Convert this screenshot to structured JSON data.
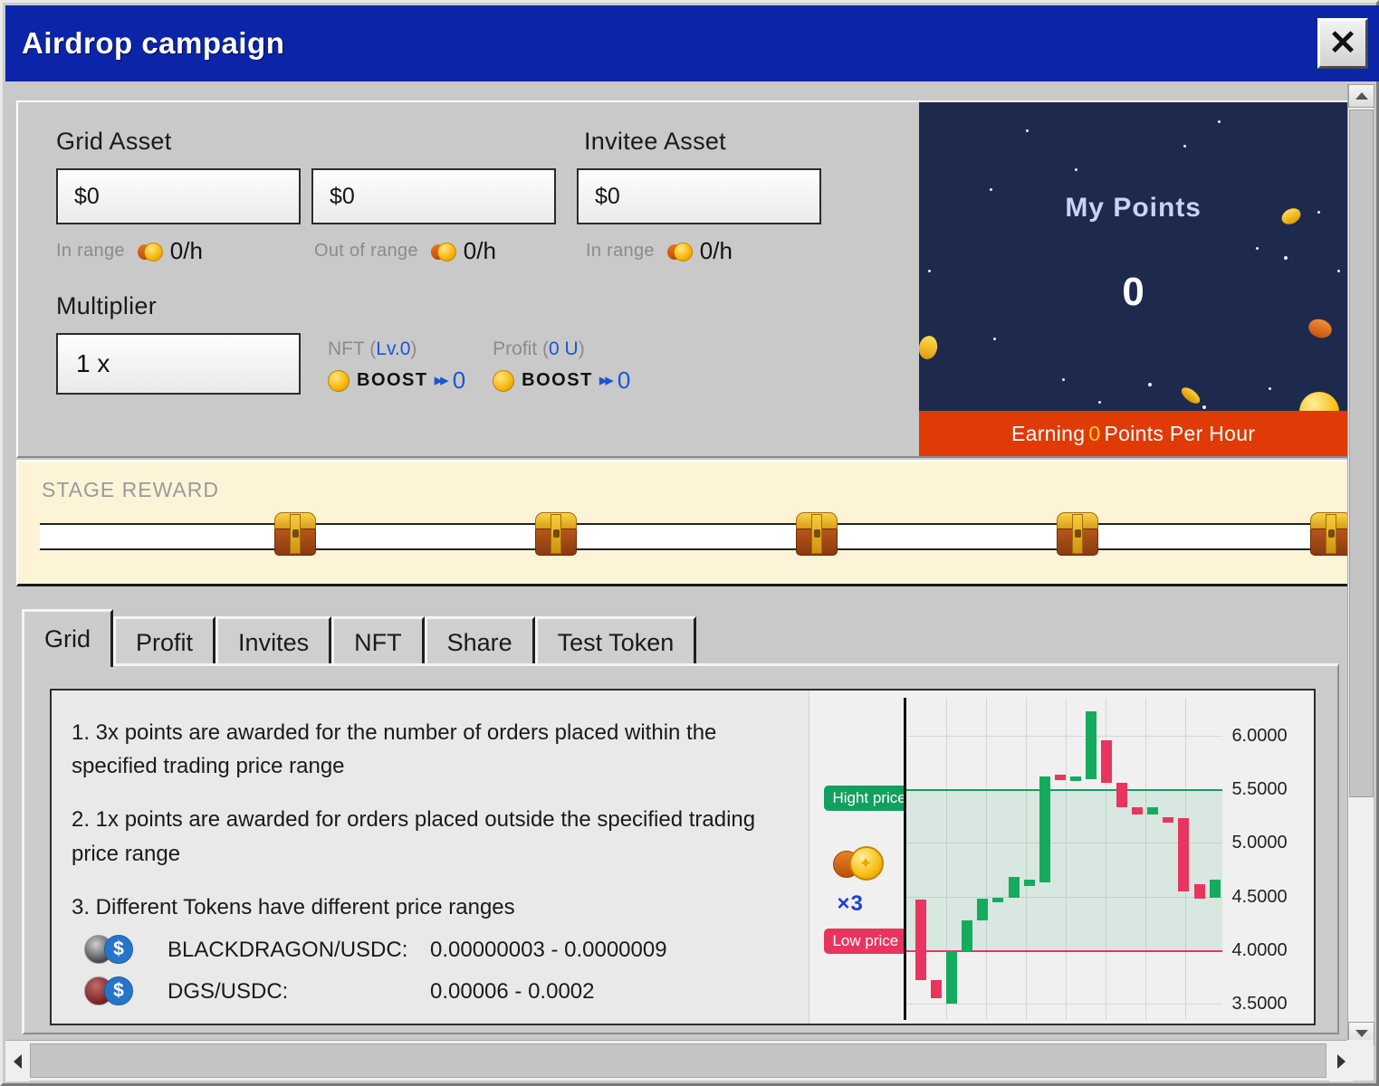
{
  "window": {
    "title": "Airdrop campaign",
    "close_label": "✕"
  },
  "stats": {
    "grid_asset_label": "Grid Asset",
    "invitee_asset_label": "Invitee Asset",
    "grid_in_value": "$0",
    "grid_out_value": "$0",
    "invitee_value": "$0",
    "in_range_label": "In range",
    "out_of_range_label": "Out of range",
    "invitee_in_range_label": "In range",
    "grid_in_rate": "0/h",
    "grid_out_rate": "0/h",
    "invitee_rate": "0/h",
    "multiplier_label": "Multiplier",
    "multiplier_value": "1 x",
    "nft_head_prefix": "NFT (",
    "nft_head_value": "Lv.0",
    "nft_head_suffix": ")",
    "profit_head_prefix": "Profit (",
    "profit_head_value": "0 U",
    "profit_head_suffix": ")",
    "boost_word": "BOOST",
    "boost_arrow": "▸▸",
    "nft_boost_value": "0",
    "profit_boost_value": "0"
  },
  "points": {
    "title": "My Points",
    "value": "0",
    "earning_prefix": "Earning",
    "earning_value": "0",
    "earning_suffix": "Points Per Hour"
  },
  "stage": {
    "label": "STAGE REWARD",
    "chest_count": 5,
    "chest_positions": [
      283,
      571,
      859,
      1147,
      1427
    ]
  },
  "tabs": [
    {
      "label": "Grid",
      "active": true
    },
    {
      "label": "Profit",
      "active": false
    },
    {
      "label": "Invites",
      "active": false
    },
    {
      "label": "NFT",
      "active": false
    },
    {
      "label": "Share",
      "active": false
    },
    {
      "label": "Test Token",
      "active": false
    }
  ],
  "grid_tab": {
    "rule1": "1. 3x points are awarded for the number of orders placed within the specified trading price range",
    "rule2": "2. 1x points are awarded for orders placed outside the specified trading price range",
    "rule3": "3. Different Tokens have different price ranges",
    "tokens": [
      {
        "name": "BLACKDRAGON/USDC:",
        "range": "0.00000003 - 0.0000009",
        "quote_symbol": "$"
      },
      {
        "name": "DGS/USDC:",
        "range": "0.00006 - 0.0002",
        "quote_symbol": "$"
      }
    ]
  },
  "chart_data": {
    "type": "bar",
    "title": "",
    "xlabel": "",
    "ylabel": "",
    "ylim": [
      3.35,
      6.35
    ],
    "grid": true,
    "yticks": [
      "6.0000",
      "5.5000",
      "5.0000",
      "4.5000",
      "4.0000",
      "3.5000"
    ],
    "ytick_values": [
      6.0,
      5.5,
      5.0,
      4.5,
      4.0,
      3.5
    ],
    "high_price_label": "Hight price",
    "low_price_label": "Low price",
    "high_price": 5.5,
    "low_price": 4.0,
    "multiplier_label": "×3",
    "candles": [
      {
        "open": 4.47,
        "close": 3.72,
        "dir": "down"
      },
      {
        "open": 3.72,
        "close": 3.55,
        "dir": "down"
      },
      {
        "open": 3.5,
        "close": 3.99,
        "dir": "up"
      },
      {
        "open": 3.99,
        "close": 4.28,
        "dir": "up"
      },
      {
        "open": 4.28,
        "close": 4.48,
        "dir": "up"
      },
      {
        "open": 4.48,
        "close": 4.49,
        "dir": "up"
      },
      {
        "open": 4.49,
        "close": 4.68,
        "dir": "up"
      },
      {
        "open": 4.6,
        "close": 4.66,
        "dir": "up"
      },
      {
        "open": 4.63,
        "close": 5.62,
        "dir": "up"
      },
      {
        "open": 5.58,
        "close": 5.63,
        "dir": "down"
      },
      {
        "open": 5.6,
        "close": 5.62,
        "dir": "up"
      },
      {
        "open": 5.59,
        "close": 6.22,
        "dir": "up"
      },
      {
        "open": 5.95,
        "close": 5.56,
        "dir": "down"
      },
      {
        "open": 5.56,
        "close": 5.33,
        "dir": "down"
      },
      {
        "open": 5.33,
        "close": 5.26,
        "dir": "down"
      },
      {
        "open": 5.26,
        "close": 5.33,
        "dir": "up"
      },
      {
        "open": 5.24,
        "close": 5.19,
        "dir": "down"
      },
      {
        "open": 5.23,
        "close": 4.55,
        "dir": "down"
      },
      {
        "open": 4.61,
        "close": 4.48,
        "dir": "down"
      },
      {
        "open": 4.49,
        "close": 4.66,
        "dir": "up"
      }
    ]
  },
  "scrollbars": {
    "up_arrow": "▲",
    "down_arrow": "▼",
    "left_arrow": "◀",
    "right_arrow": "▶"
  }
}
